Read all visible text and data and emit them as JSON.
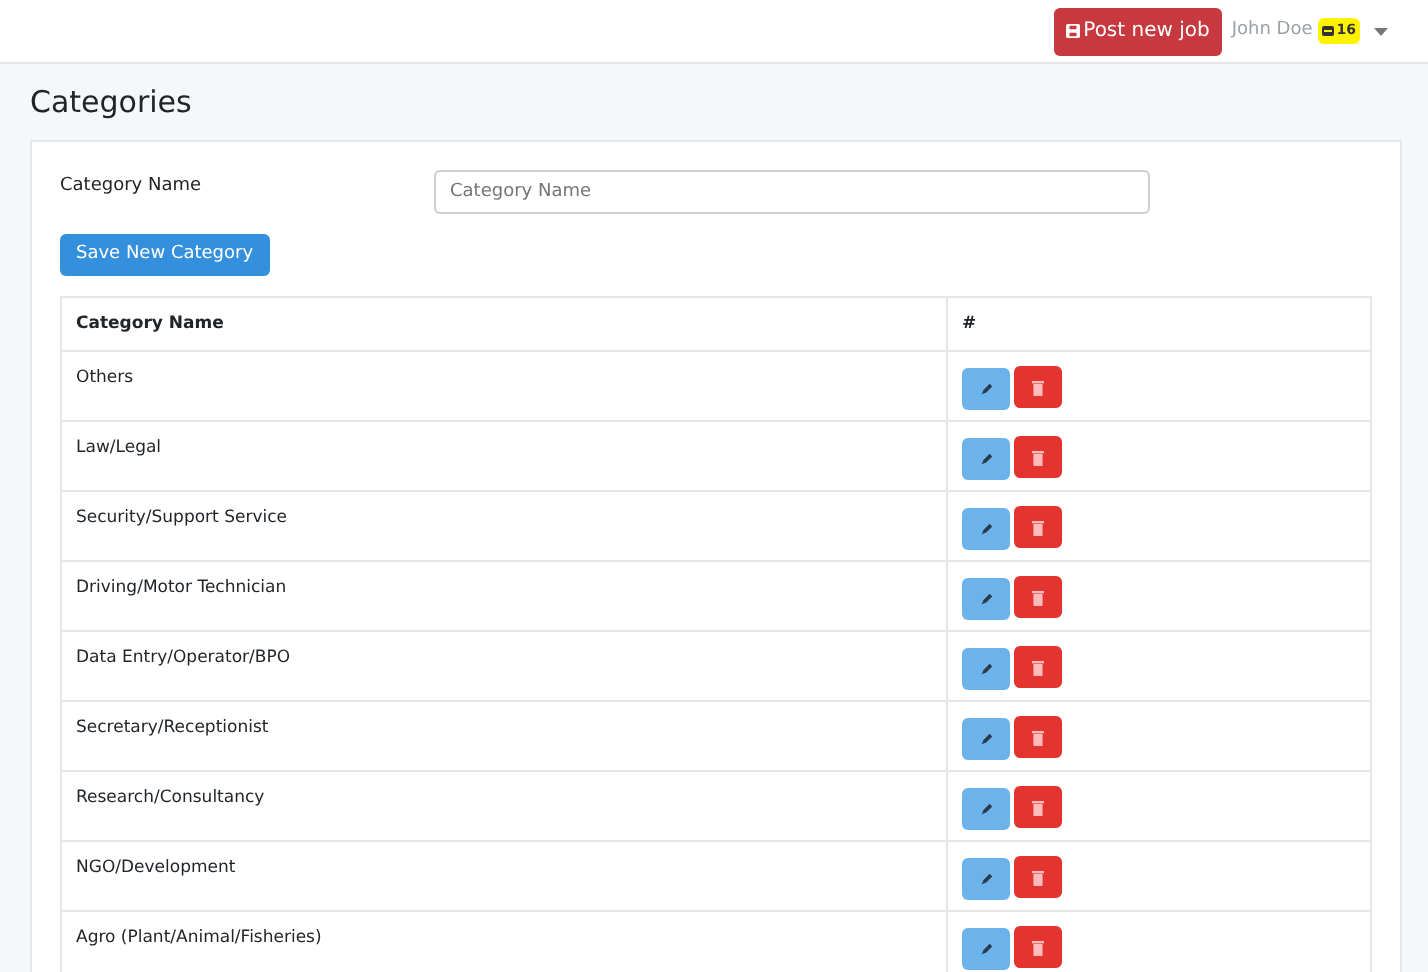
{
  "navbar": {
    "post_button": "Post new job",
    "user_name": "John Doe",
    "badge": "16"
  },
  "page_title": "Categories",
  "form": {
    "label": "Category Name",
    "placeholder": "Category Name",
    "save_button": "Save New Category"
  },
  "table": {
    "columns": [
      "Category Name",
      "#"
    ],
    "rows": [
      {
        "name": "Others"
      },
      {
        "name": "Law/Legal"
      },
      {
        "name": "Security/Support Service"
      },
      {
        "name": "Driving/Motor Technician"
      },
      {
        "name": "Data Entry/Operator/BPO"
      },
      {
        "name": "Secretary/Receptionist"
      },
      {
        "name": "Research/Consultancy"
      },
      {
        "name": "NGO/Development"
      },
      {
        "name": "Agro (Plant/Animal/Fisheries)"
      }
    ]
  }
}
